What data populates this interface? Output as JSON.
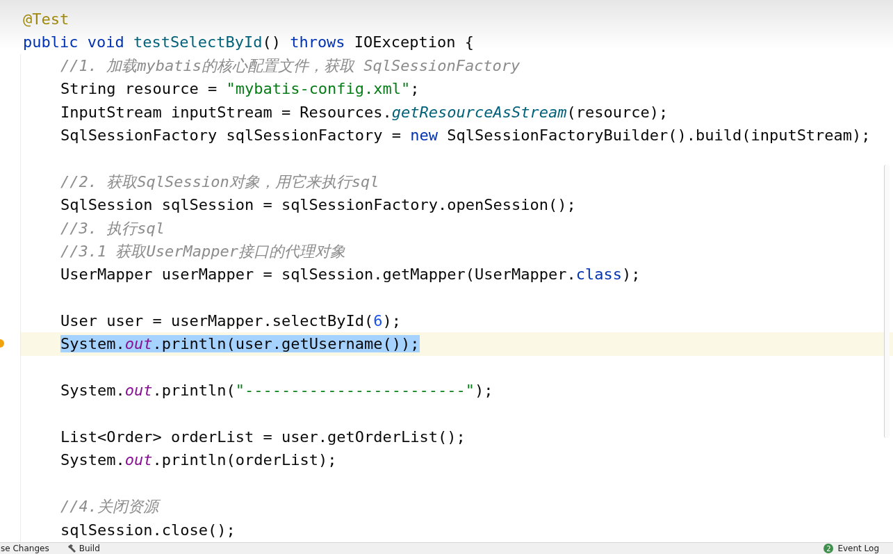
{
  "editor": {
    "lines": [
      {
        "kind": "code",
        "selected": false,
        "tokens": [
          {
            "kind": "annotation",
            "text": "@Test"
          }
        ]
      },
      {
        "kind": "code",
        "selected": false,
        "tokens": [
          {
            "kind": "keyword",
            "text": "public void "
          },
          {
            "kind": "declaration",
            "text": "testSelectById"
          },
          {
            "kind": "plain",
            "text": "() "
          },
          {
            "kind": "keyword",
            "text": "throws "
          },
          {
            "kind": "plain",
            "text": "IOException {"
          }
        ],
        "children": [
          {
            "kind": "code",
            "selected": false,
            "tokens": [
              {
                "kind": "comment",
                "text": "//1. 加载mybatis的核心配置文件，获取 SqlSessionFactory"
              }
            ]
          },
          {
            "kind": "code",
            "selected": false,
            "tokens": [
              {
                "kind": "plain",
                "text": "String resource = "
              },
              {
                "kind": "string",
                "text": "\"mybatis-config.xml\""
              },
              {
                "kind": "plain",
                "text": ";"
              }
            ]
          },
          {
            "kind": "code",
            "selected": false,
            "tokens": [
              {
                "kind": "plain",
                "text": "InputStream inputStream = Resources."
              },
              {
                "kind": "static_method",
                "text": "getResourceAsStream"
              },
              {
                "kind": "plain",
                "text": "(resource);"
              }
            ]
          },
          {
            "kind": "code",
            "selected": false,
            "tokens": [
              {
                "kind": "plain",
                "text": "SqlSessionFactory sqlSessionFactory = "
              },
              {
                "kind": "keyword",
                "text": "new "
              },
              {
                "kind": "plain",
                "text": "SqlSessionFactoryBuilder().build(inputStream);"
              }
            ]
          },
          {
            "kind": "blank",
            "selected": false
          },
          {
            "kind": "code",
            "selected": false,
            "tokens": [
              {
                "kind": "comment",
                "text": "//2. 获取SqlSession对象，用它来执行sql"
              }
            ]
          },
          {
            "kind": "code",
            "selected": false,
            "tokens": [
              {
                "kind": "plain",
                "text": "SqlSession sqlSession = sqlSessionFactory.openSession();"
              }
            ]
          },
          {
            "kind": "code",
            "selected": false,
            "tokens": [
              {
                "kind": "comment",
                "text": "//3. 执行sql"
              }
            ]
          },
          {
            "kind": "code",
            "selected": false,
            "tokens": [
              {
                "kind": "comment",
                "text": "//3.1 获取UserMapper接口的代理对象"
              }
            ]
          },
          {
            "kind": "code",
            "selected": false,
            "tokens": [
              {
                "kind": "plain",
                "text": "UserMapper userMapper = sqlSession.getMapper(UserMapper."
              },
              {
                "kind": "keyword",
                "text": "class"
              },
              {
                "kind": "plain",
                "text": ");"
              }
            ]
          },
          {
            "kind": "blank",
            "selected": false
          },
          {
            "kind": "code",
            "selected": false,
            "tokens": [
              {
                "kind": "plain",
                "text": "User user = userMapper.selectById("
              },
              {
                "kind": "number",
                "text": "6"
              },
              {
                "kind": "plain",
                "text": ");"
              }
            ]
          },
          {
            "kind": "code",
            "selected": true,
            "tokens": [
              {
                "kind": "plain",
                "text": "System."
              },
              {
                "kind": "static_field",
                "text": "out"
              },
              {
                "kind": "plain",
                "text": ".println(user.getUsername());"
              }
            ]
          },
          {
            "kind": "blank",
            "selected": false
          },
          {
            "kind": "code",
            "selected": false,
            "tokens": [
              {
                "kind": "plain",
                "text": "System."
              },
              {
                "kind": "static_field",
                "text": "out"
              },
              {
                "kind": "plain",
                "text": ".println("
              },
              {
                "kind": "string",
                "text": "\"------------------------\""
              },
              {
                "kind": "plain",
                "text": ");"
              }
            ]
          },
          {
            "kind": "blank",
            "selected": false
          },
          {
            "kind": "code",
            "selected": false,
            "tokens": [
              {
                "kind": "plain",
                "text": "List<Order> orderList = user.getOrderList();"
              }
            ]
          },
          {
            "kind": "code",
            "selected": false,
            "tokens": [
              {
                "kind": "plain",
                "text": "System."
              },
              {
                "kind": "static_field",
                "text": "out"
              },
              {
                "kind": "plain",
                "text": ".println(orderList);"
              }
            ]
          },
          {
            "kind": "blank",
            "selected": false
          },
          {
            "kind": "code",
            "selected": false,
            "tokens": [
              {
                "kind": "comment",
                "text": "//4.关闭资源"
              }
            ]
          },
          {
            "kind": "code",
            "selected": false,
            "tokens": [
              {
                "kind": "plain",
                "text": "sqlSession.close();"
              }
            ]
          }
        ]
      }
    ]
  },
  "status_bar": {
    "left": [
      {
        "kind": "text",
        "label": "se Changes"
      },
      {
        "kind": "build",
        "label": "Build"
      }
    ],
    "event_log": {
      "count": "2",
      "label": "Event Log"
    }
  }
}
